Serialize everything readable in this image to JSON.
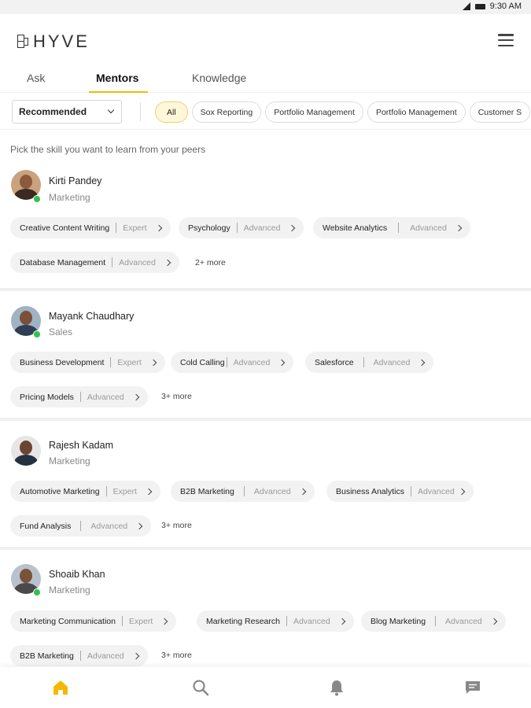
{
  "status": {
    "time": "9:30 AM"
  },
  "app": {
    "logo_text": "HYVE"
  },
  "tabs": [
    {
      "label": "Ask"
    },
    {
      "label": "Mentors"
    },
    {
      "label": "Knowledge"
    }
  ],
  "filter": {
    "dropdown_value": "Recommended",
    "chips": [
      "All",
      "Sox Reporting",
      "Portfolio Management",
      "Portfolio Management",
      "Customer S"
    ]
  },
  "hint": "Pick the skill you want to learn from your peers",
  "mentors": [
    {
      "name": "Kirti Pandey",
      "role": "Marketing",
      "skills": [
        {
          "name": "Creative Content Writing",
          "level": "Expert"
        },
        {
          "name": "Psychology",
          "level": "Advanced"
        },
        {
          "name": "Website Analytics",
          "level": "Advanced"
        },
        {
          "name": "Database Management",
          "level": "Advanced"
        }
      ],
      "more": "2+ more"
    },
    {
      "name": "Mayank Chaudhary",
      "role": "Sales",
      "skills": [
        {
          "name": "Business Development",
          "level": "Expert"
        },
        {
          "name": "Cold Calling",
          "level": "Advanced"
        },
        {
          "name": "Salesforce",
          "level": "Advanced"
        },
        {
          "name": "Pricing Models",
          "level": "Advanced"
        }
      ],
      "more": "3+ more"
    },
    {
      "name": "Rajesh Kadam",
      "role": "Marketing",
      "skills": [
        {
          "name": "Automotive Marketing",
          "level": "Expert"
        },
        {
          "name": "B2B Marketing",
          "level": "Advanced"
        },
        {
          "name": "Business Analytics",
          "level": "Advanced"
        },
        {
          "name": "Fund Analysis",
          "level": "Advanced"
        }
      ],
      "more": "3+ more"
    },
    {
      "name": "Shoaib Khan",
      "role": "Marketing",
      "skills": [
        {
          "name": "Marketing Communication",
          "level": "Expert"
        },
        {
          "name": "Marketing Research",
          "level": "Advanced"
        },
        {
          "name": "Blog Marketing",
          "level": "Advanced"
        },
        {
          "name": "B2B Marketing",
          "level": "Advanced"
        }
      ],
      "more": "3+ more"
    }
  ],
  "bottom_nav": [
    {
      "icon": "home-icon"
    },
    {
      "icon": "search-icon"
    },
    {
      "icon": "bell-icon"
    },
    {
      "icon": "chat-icon"
    }
  ],
  "colors": {
    "accent": "#f5b800",
    "online": "#2ec44a"
  }
}
